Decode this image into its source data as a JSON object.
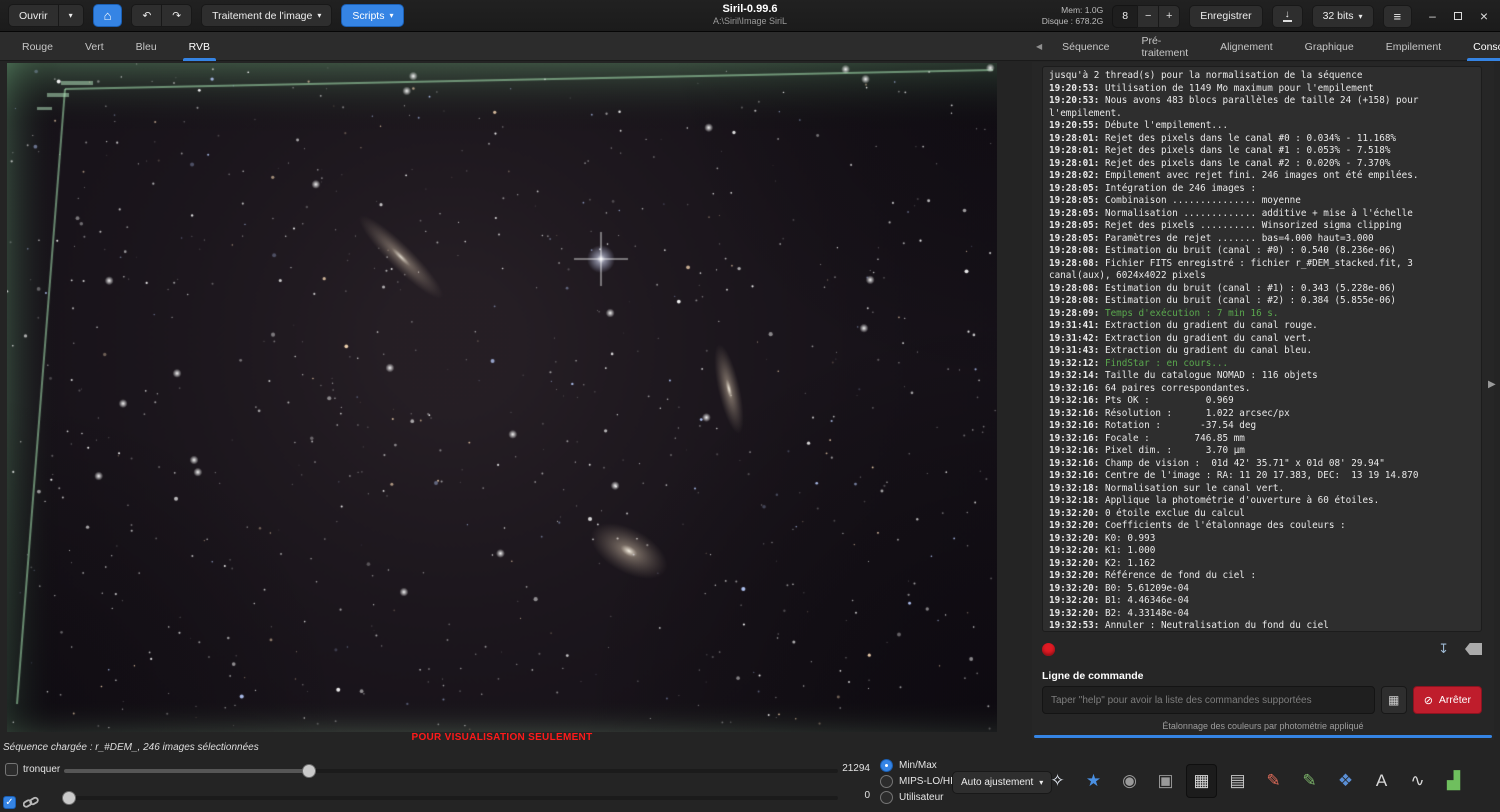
{
  "titlebar": {
    "open": "Ouvrir",
    "image_processing": "Traitement de l'image",
    "scripts": "Scripts",
    "title": "Siril-0.99.6",
    "subtitle": "A:\\Siril\\Image SiriL",
    "mem": "Mem: 1.0G",
    "disk": "Disque : 678.2G",
    "threads": "8",
    "save": "Enregistrer",
    "bits": "32 bits"
  },
  "icons": {
    "caret": "▾",
    "home": "⌂",
    "undo": "↶",
    "redo": "↷",
    "minus": "−",
    "plus": "+",
    "download": "↓",
    "menu": "≡",
    "minimize": "–",
    "close": "×",
    "scroll_left": "◀",
    "scroll_right": "▶",
    "grid": "▦",
    "stop": "⊘",
    "expander": "▶",
    "check": "✓",
    "save_log": "↧"
  },
  "channel_tabs": {
    "items": [
      "Rouge",
      "Vert",
      "Bleu",
      "RVB"
    ],
    "active": "RVB"
  },
  "right_tabs": {
    "items": [
      "Séquence",
      "Pré-traitement",
      "Alignement",
      "Graphique",
      "Empilement",
      "Console"
    ],
    "active": "Console"
  },
  "image": {
    "warning": "POUR VISUALISATION SEULEMENT"
  },
  "status": {
    "sequence": "Séquence chargée : r_#DEM_, 246 images sélectionnées"
  },
  "console": {
    "lines": [
      {
        "time": "",
        "text": "jusqu'à 2 thread(s) pour la normalisation de la séquence"
      },
      {
        "time": "19:20:53:",
        "text": " Utilisation de 1149 Mo maximum pour l'empilement"
      },
      {
        "time": "19:20:53:",
        "text": " Nous avons 483 blocs parallèles de taille 24 (+158) pour l'empilement."
      },
      {
        "time": "19:20:55:",
        "text": " Débute l'empilement..."
      },
      {
        "time": "19:28:01:",
        "text": " Rejet des pixels dans le canal #0 : 0.034% - 11.168%"
      },
      {
        "time": "19:28:01:",
        "text": " Rejet des pixels dans le canal #1 : 0.053% - 7.518%"
      },
      {
        "time": "19:28:01:",
        "text": " Rejet des pixels dans le canal #2 : 0.020% - 7.370%"
      },
      {
        "time": "19:28:02:",
        "text": " Empilement avec rejet fini. 246 images ont été empilées."
      },
      {
        "time": "19:28:05:",
        "text": " Intégration de 246 images :"
      },
      {
        "time": "19:28:05:",
        "text": " Combinaison ............... moyenne"
      },
      {
        "time": "19:28:05:",
        "text": " Normalisation ............. additive + mise à l'échelle"
      },
      {
        "time": "19:28:05:",
        "text": " Rejet des pixels .......... Winsorized sigma clipping"
      },
      {
        "time": "19:28:05:",
        "text": " Paramètres de rejet ....... bas=4.000 haut=3.000"
      },
      {
        "time": "19:28:08:",
        "text": " Estimation du bruit (canal : #0) : 0.540 (8.236e-06)"
      },
      {
        "time": "19:28:08:",
        "text": " Fichier FITS enregistré : fichier r_#DEM_stacked.fit, 3 canal(aux), 6024x4022 pixels"
      },
      {
        "time": "19:28:08:",
        "text": " Estimation du bruit (canal : #1) : 0.343 (5.228e-06)"
      },
      {
        "time": "19:28:08:",
        "text": " Estimation du bruit (canal : #2) : 0.384 (5.855e-06)"
      },
      {
        "time": "19:28:09:",
        "text": " Temps d'exécution : 7 min 16 s.",
        "green": true
      },
      {
        "time": "19:31:41:",
        "text": " Extraction du gradient du canal rouge."
      },
      {
        "time": "19:31:42:",
        "text": " Extraction du gradient du canal vert."
      },
      {
        "time": "19:31:43:",
        "text": " Extraction du gradient du canal bleu."
      },
      {
        "time": "19:32:12:",
        "text": " FindStar : en cours...",
        "green": true
      },
      {
        "time": "19:32:14:",
        "text": " Taille du catalogue NOMAD : 116 objets"
      },
      {
        "time": "19:32:16:",
        "text": " 64 paires correspondantes."
      },
      {
        "time": "19:32:16:",
        "text": " Pts OK :          0.969"
      },
      {
        "time": "19:32:16:",
        "text": " Résolution :      1.022 arcsec/px"
      },
      {
        "time": "19:32:16:",
        "text": " Rotation :       -37.54 deg"
      },
      {
        "time": "19:32:16:",
        "text": " Focale :        746.85 mm"
      },
      {
        "time": "19:32:16:",
        "text": " Pixel dim. :      3.70 µm"
      },
      {
        "time": "19:32:16:",
        "text": " Champ de vision :  01d 42' 35.71\" x 01d 08' 29.94\""
      },
      {
        "time": "19:32:16:",
        "text": " Centre de l'image : RA: 11 20 17.383, DEC:  13 19 14.870"
      },
      {
        "time": "19:32:18:",
        "text": " Normalisation sur le canal vert."
      },
      {
        "time": "19:32:18:",
        "text": " Applique la photométrie d'ouverture à 60 étoiles."
      },
      {
        "time": "19:32:20:",
        "text": " 0 étoile exclue du calcul"
      },
      {
        "time": "19:32:20:",
        "text": " Coefficients de l'étalonnage des couleurs :"
      },
      {
        "time": "19:32:20:",
        "text": " K0: 0.993"
      },
      {
        "time": "19:32:20:",
        "text": " K1: 1.000"
      },
      {
        "time": "19:32:20:",
        "text": " K2: 1.162"
      },
      {
        "time": "19:32:20:",
        "text": " Référence de fond du ciel :"
      },
      {
        "time": "19:32:20:",
        "text": " B0: 5.61209e-04"
      },
      {
        "time": "19:32:20:",
        "text": " B1: 4.46346e-04"
      },
      {
        "time": "19:32:20:",
        "text": " B2: 4.33148e-04"
      },
      {
        "time": "19:32:53:",
        "text": " Annuler : Neutralisation du fond du ciel"
      }
    ]
  },
  "command": {
    "label": "Ligne de commande",
    "placeholder": "Taper \"help\" pour avoir la liste des commandes supportées",
    "stop": "Arrêter"
  },
  "progress": {
    "text": "Étalonnage des couleurs par photométrie appliqué"
  },
  "display": {
    "truncate": "tronquer",
    "hi": "21294",
    "lo": "0",
    "modes": [
      "Min/Max",
      "MIPS-LO/HI",
      "Utilisateur"
    ],
    "mode_selected": "Min/Max",
    "autoadjust": "Auto ajustement"
  },
  "toolbar_icons": [
    {
      "name": "star-fitting-icon",
      "glyph": "✧",
      "color": "#e8eef8"
    },
    {
      "name": "star-detection-icon",
      "glyph": "★",
      "color": "#4a90e2"
    },
    {
      "name": "photometry-icon",
      "glyph": "◉",
      "color": "#9a9a9a"
    },
    {
      "name": "aperture-icon",
      "glyph": "▣",
      "color": "#9a9a9a"
    },
    {
      "name": "pixel-grid-icon",
      "glyph": "▦",
      "color": "#d8d8d8",
      "pressed": true
    },
    {
      "name": "sampling-grid-icon",
      "glyph": "▤",
      "color": "#c8c8c8"
    },
    {
      "name": "background-samples-icon",
      "glyph": "✎",
      "color": "#e06c5a"
    },
    {
      "name": "gradient-pencil-icon",
      "glyph": "✎",
      "color": "#7cb46a"
    },
    {
      "name": "rgb-compositing-icon",
      "glyph": "❖",
      "color": "#5a8fd6"
    },
    {
      "name": "annotation-icon",
      "glyph": "A",
      "color": "#d8d8d8"
    },
    {
      "name": "histogram-transform-icon",
      "glyph": "∿",
      "color": "#d8d8d8"
    },
    {
      "name": "statistics-icon",
      "glyph": "▟",
      "color": "#6fbf5e"
    }
  ],
  "colors": {
    "accent": "#3584e4",
    "console_green": "#5aa84e",
    "warning_red": "#ff1a1a",
    "stop_red": "#bf1d2c"
  }
}
